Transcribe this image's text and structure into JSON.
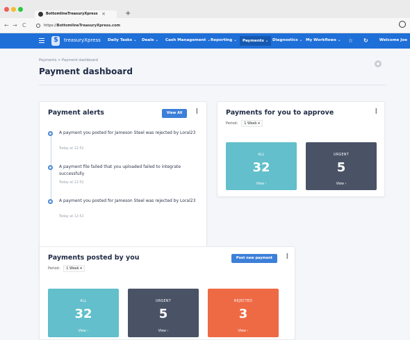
{
  "browser": {
    "tab_title": "BottomlineTreasuryXpress",
    "tab_close": "×",
    "new_tab": "+",
    "back": "←",
    "forward": "→",
    "reload": "C",
    "url_prefix": "https://",
    "url_host": "BottomlineTreasuryXpress.com"
  },
  "appnav": {
    "logo": "treasuryXpress",
    "items": [
      "Daily Tasks ⌄",
      "Deals ⌄",
      "Cash Management ⌄",
      "Reporting ⌄",
      "Payments ⌄",
      "Diagnostics ⌄",
      "My Workflows ⌄"
    ],
    "active_index": 4,
    "star": "☆",
    "refresh": "↻",
    "welcome": "Welcome Joe"
  },
  "page": {
    "breadcrumb": "Payments  >  Payment dashboard",
    "title": "Payment dashboard"
  },
  "alerts": {
    "title": "Payment alerts",
    "view_all": "View All",
    "items": [
      {
        "message": "A payment you posted for Jameson Steel was rejected by Loral23",
        "time": "Today at 12:52"
      },
      {
        "message": "A payment file failed that you uploaded failed to integrate successfully",
        "time": "Today at 12:52"
      },
      {
        "message": "A payment you posted for Jameson Steel was rejected by Loral23",
        "time": "Today at 12:52"
      }
    ]
  },
  "approve": {
    "title": "Payments for you to approve",
    "period_label": "Period:",
    "period_value": "1 Week  ▾",
    "tiles": [
      {
        "label": "ALL",
        "count": "32",
        "view": "View  ›",
        "color": "#62bfcb"
      },
      {
        "label": "URGENT",
        "count": "5",
        "view": "View  ›",
        "color": "#4a5266"
      }
    ]
  },
  "posted": {
    "title": "Payments posted by you",
    "post_button": "Post new payment",
    "period_label": "Period:",
    "period_value": "1 Week  ▾",
    "tiles": [
      {
        "label": "ALL",
        "count": "32",
        "view": "View  ›",
        "color": "#62bfcb"
      },
      {
        "label": "URGENT",
        "count": "5",
        "view": "View  ›",
        "color": "#4a5266"
      },
      {
        "label": "REJECTED",
        "count": "3",
        "view": "View  ›",
        "color": "#ee6a45"
      }
    ]
  },
  "colors": {
    "nav_bg": "#1f6fd8",
    "primary_button": "#3c7fd8",
    "page_bg": "#f4f6fa"
  }
}
